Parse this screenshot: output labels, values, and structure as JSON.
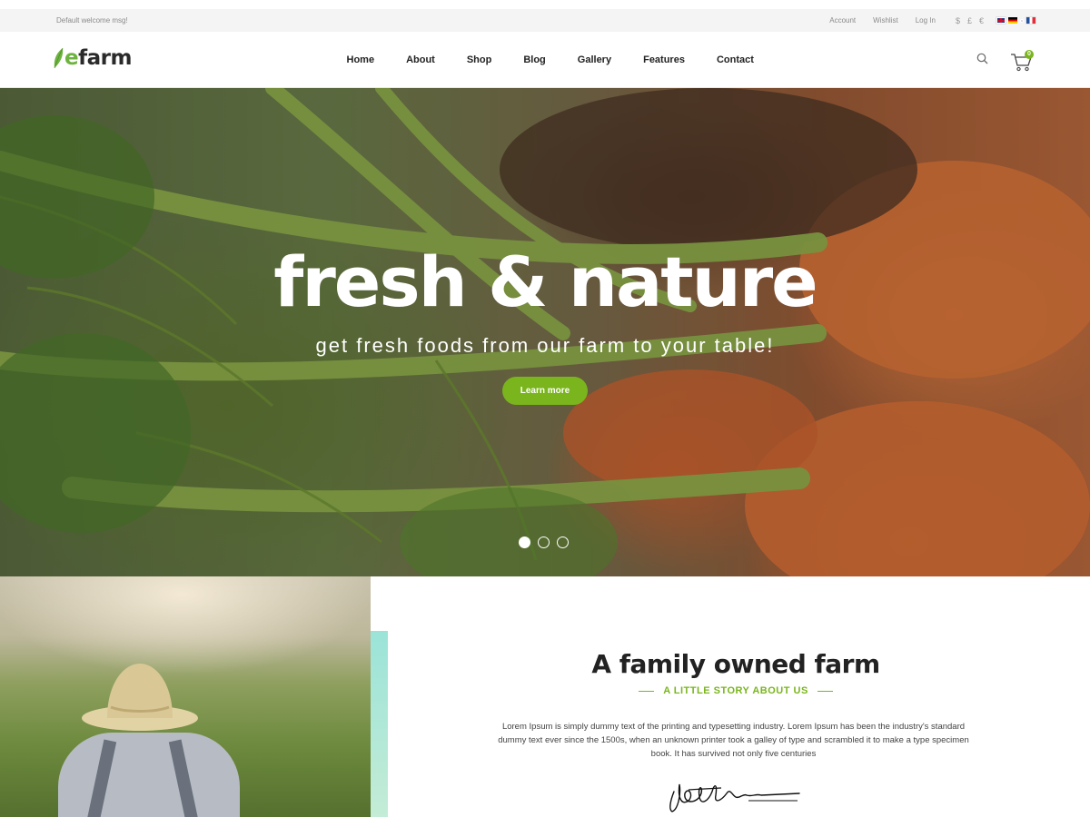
{
  "topbar": {
    "welcome": "Default welcome msg!",
    "links": [
      "Account",
      "Wishlist",
      "Log In"
    ],
    "currencies": [
      "$",
      "£",
      "€"
    ],
    "languages": [
      "en-flag-icon",
      "de-flag-icon",
      "dot-icon",
      "fr-flag-icon"
    ]
  },
  "header": {
    "logo_e": "e",
    "logo_rest": "farm",
    "nav": [
      "Home",
      "About",
      "Shop",
      "Blog",
      "Gallery",
      "Features",
      "Contact"
    ],
    "cart_count": "0",
    "icons": [
      "search-icon",
      "cart-icon"
    ]
  },
  "hero": {
    "title": "fresh & nature",
    "subtitle": "get fresh foods from our farm to your table!",
    "button": "Learn more",
    "slides": 3,
    "active_slide": 1
  },
  "story": {
    "title": "A family owned farm",
    "kicker": "A LITTLE STORY ABOUT US",
    "text": "Lorem Ipsum is simply dummy text of the printing and typesetting industry. Lorem Ipsum has been the industry's standard dummy text ever since the 1500s, when an unknown printer took a galley of type and scrambled it to make a type specimen book. It has survived not only five centuries"
  },
  "colors": {
    "accent": "#7ab51d",
    "teal_bar": "#9be3d8"
  }
}
